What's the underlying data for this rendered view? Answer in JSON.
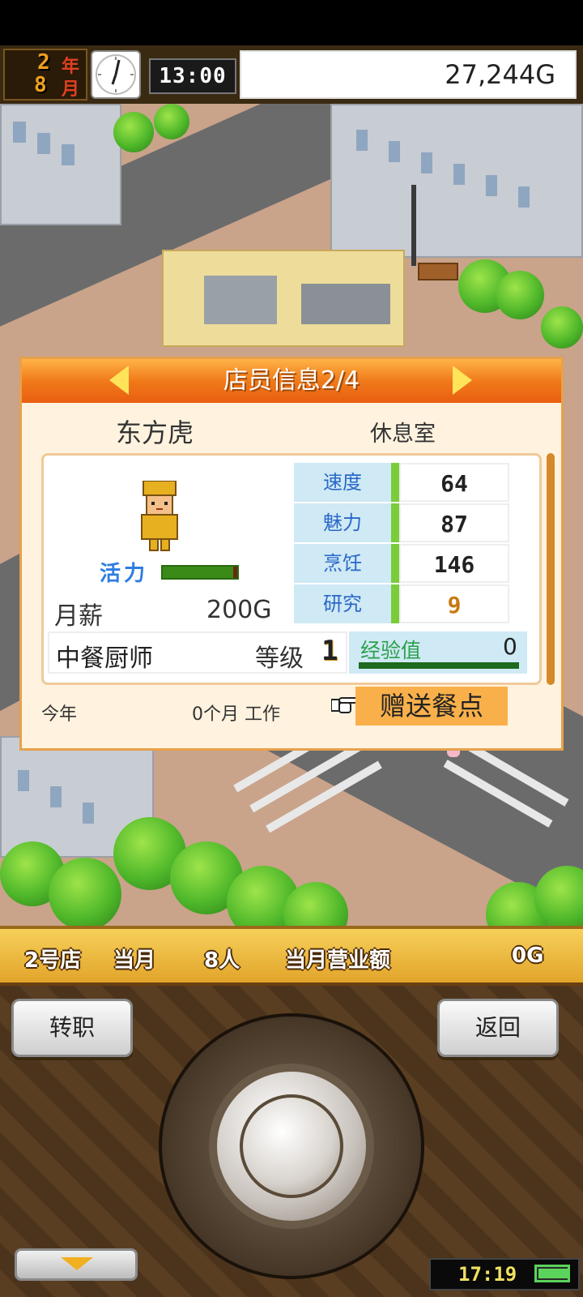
{
  "status": {
    "year": "2",
    "year_unit": "年",
    "month": "8",
    "month_unit": "月",
    "time": "13:00",
    "money": "27,244G"
  },
  "dialog": {
    "title": "店员信息2/4",
    "staff_name": "东方虎",
    "location": "休息室",
    "vitality_label": "活力",
    "vitality_level": 0.95,
    "salary_label": "月薪",
    "salary_value": "200G",
    "stats": [
      {
        "label": "速度",
        "value": "64"
      },
      {
        "label": "魅力",
        "value": "87"
      },
      {
        "label": "烹饪",
        "value": "146"
      },
      {
        "label": "研究",
        "value": "9"
      }
    ],
    "job": "中餐厨师",
    "level_label": "等级",
    "level_value": "1",
    "exp_label": "经验值",
    "exp_value": "0",
    "year_label": "今年",
    "work_text": "0个月 工作",
    "gift_button": "赠送餐点"
  },
  "info_bar": {
    "store": "2号店",
    "this_month": "当月",
    "staff_count": "8人",
    "sales_label": "当月营业额",
    "sales_value": "0G"
  },
  "controls": {
    "transfer_button": "转职",
    "back_button": "返回",
    "clock": "17:19"
  },
  "colors": {
    "header_orange": "#f07a1a",
    "stat_label_bg": "#cfe9f5",
    "gift_button_bg": "#f9b04a"
  }
}
